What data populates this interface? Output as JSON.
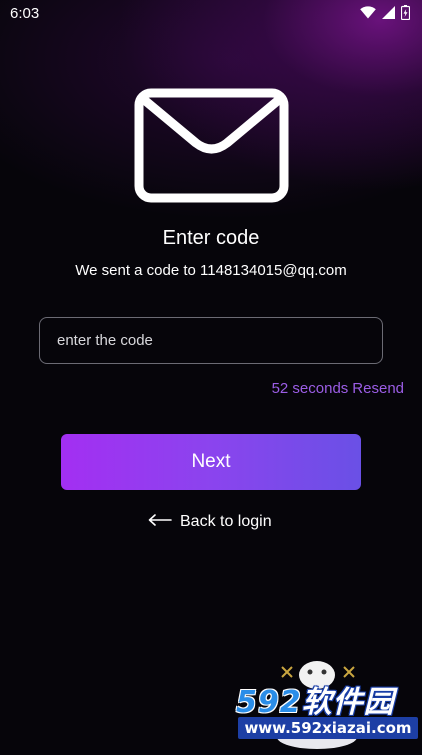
{
  "status_bar": {
    "time": "6:03",
    "icons": [
      "wifi-icon",
      "signal-icon",
      "battery-icon"
    ]
  },
  "verification": {
    "icon": "mail-icon",
    "title": "Enter code",
    "subtitle": "We sent a code to 1148134015@qq.com",
    "input": {
      "placeholder": "enter the code",
      "value": ""
    },
    "countdown": "52 seconds",
    "resend_label": "Resend",
    "next_label": "Next",
    "back_label": "Back to login"
  },
  "watermark": {
    "brand": "592软件园",
    "url": "www.592xiazai.com"
  },
  "colors": {
    "background": "#06050a",
    "accent_purple": "#9b5de5",
    "button_gradient_start": "#a32ff2",
    "button_gradient_end": "#6a50e6",
    "input_border": "#6b6b74"
  }
}
